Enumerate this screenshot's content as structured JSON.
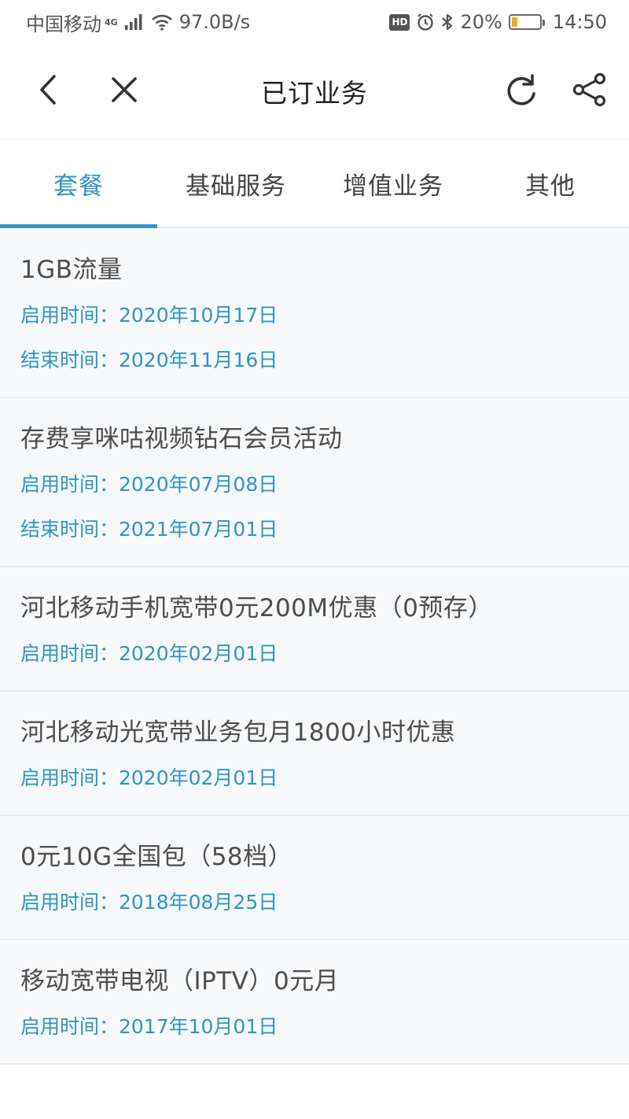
{
  "status": {
    "carrier": "中国移动",
    "network": "4G",
    "speed": "97.0B/s",
    "hd": "HD",
    "battery": "20%",
    "battery_level": 0.2,
    "time": "14:50"
  },
  "nav": {
    "title": "已订业务"
  },
  "tabs": [
    {
      "label": "套餐",
      "active": true
    },
    {
      "label": "基础服务",
      "active": false
    },
    {
      "label": "增值业务",
      "active": false
    },
    {
      "label": "其他",
      "active": false
    }
  ],
  "items": [
    {
      "title": "1GB流量",
      "start": "启用时间：2020年10月17日",
      "end": "结束时间：2020年11月16日"
    },
    {
      "title": "存费享咪咕视频钻石会员活动",
      "start": "启用时间：2020年07月08日",
      "end": "结束时间：2021年07月01日"
    },
    {
      "title": "河北移动手机宽带0元200M优惠（0预存）",
      "start": "启用时间：2020年02月01日"
    },
    {
      "title": "河北移动光宽带业务包月1800小时优惠",
      "start": "启用时间：2020年02月01日"
    },
    {
      "title": "0元10G全国包（58档）",
      "start": "启用时间：2018年08月25日"
    },
    {
      "title": "移动宽带电视（IPTV）0元月",
      "start": "启用时间：2017年10月01日"
    }
  ],
  "colors": {
    "accent": "#2f95c6",
    "item_bg": "#f8f9fb"
  }
}
